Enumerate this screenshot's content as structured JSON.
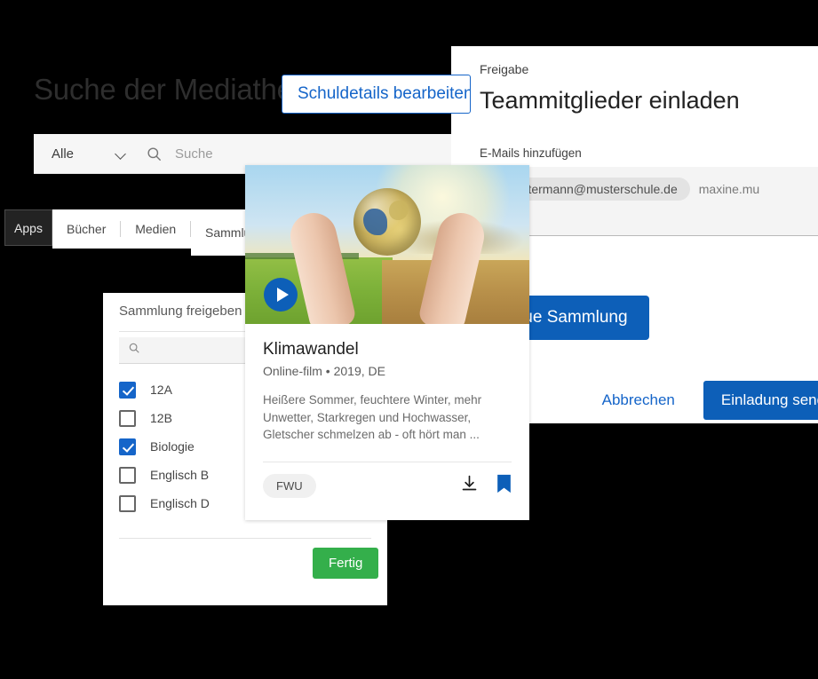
{
  "page": {
    "title": "Suche der Mediathek",
    "search": {
      "scope_label": "Alle",
      "scope_icon": "chevron-down-icon",
      "search_icon": "search-icon",
      "placeholder": "Suche",
      "value": ""
    },
    "tabs": [
      {
        "label": "Apps",
        "active": true
      },
      {
        "label": "Bücher",
        "active": false
      },
      {
        "label": "Medien",
        "active": false
      },
      {
        "label": "Sammlungen",
        "active": false
      }
    ],
    "edit_school_button": "Schuldetails bearbeiten",
    "new_collection_button": "Neue Sammlung"
  },
  "share_panel": {
    "title": "Sammlung freigeben",
    "search_icon": "search-icon",
    "search_placeholder": "",
    "groups": [
      {
        "label": "12A",
        "checked": true
      },
      {
        "label": "12B",
        "checked": false
      },
      {
        "label": "Biologie",
        "checked": true
      },
      {
        "label": "Englisch B",
        "checked": false
      },
      {
        "label": "Englisch D",
        "checked": false
      }
    ],
    "done_button": "Fertig"
  },
  "invite_dialog": {
    "eyebrow": "Freigabe",
    "title": "Teammitglieder einladen",
    "field_label": "E-Mails hinzufügen",
    "chips": [
      "mustermann@musterschule.de"
    ],
    "typing_value": "maxine.mu",
    "cancel_button": "Abbrechen",
    "submit_button": "Einladung senden"
  },
  "media_card": {
    "thumbnail_alt": "hands-holding-globe-thumbnail",
    "play_icon": "play-icon",
    "title": "Klimawandel",
    "meta": "Online-film • 2019, DE",
    "description": "Heißere Sommer, feuchtere Winter, mehr Unwetter, Starkregen und Hochwasser, Gletscher schmelzen ab - oft hört man ...",
    "provider_badge": "FWU",
    "download_icon": "download-icon",
    "bookmark_icon": "bookmark-icon"
  },
  "colors": {
    "background": "#000000",
    "primary_blue": "#0d5fb8",
    "link_blue": "#1565c9",
    "success_green": "#34af4b",
    "surface": "#ffffff",
    "field_grey": "#f4f4f4"
  }
}
